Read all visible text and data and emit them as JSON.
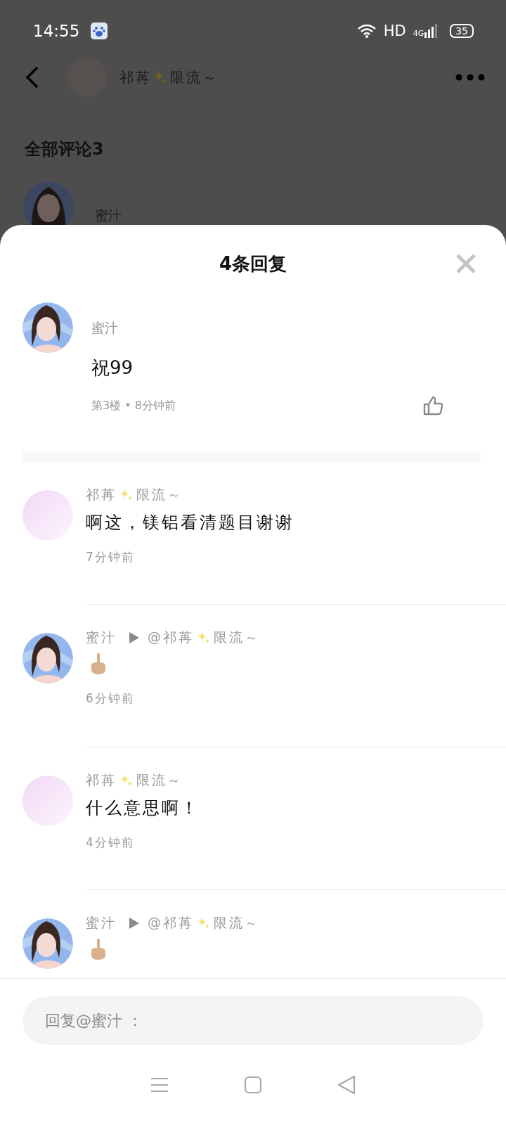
{
  "status_bar": {
    "time": "14:55",
    "network": "HD",
    "signal": "4G",
    "battery": "35"
  },
  "page": {
    "author": {
      "name": "祁苒",
      "sparkle": true,
      "suffix": "限流～"
    },
    "comments_heading": "全部评论3",
    "comment_author": "蜜汁"
  },
  "sheet": {
    "title": "4条回复",
    "main_comment": {
      "photo_avatar": true,
      "author": {
        "name": "蜜汁"
      },
      "body": "祝99",
      "meta": "第3楼 • 8分钟前"
    },
    "replies": [
      {
        "photo_avatar": false,
        "author": {
          "name": "祁苒",
          "sparkle": true,
          "suffix": "限流～"
        },
        "kind": "text",
        "body": "啊这，镁铝看清题目谢谢",
        "time": "7分钟前"
      },
      {
        "photo_avatar": true,
        "author": {
          "name": "蜜汁"
        },
        "reply_to": {
          "name": "@祁苒",
          "sparkle": true,
          "suffix": "限流～"
        },
        "kind": "emoji",
        "time": "6分钟前"
      },
      {
        "photo_avatar": false,
        "author": {
          "name": "祁苒",
          "sparkle": true,
          "suffix": "限流～"
        },
        "kind": "text",
        "body": "什么意思啊！",
        "time": "4分钟前"
      },
      {
        "photo_avatar": true,
        "author": {
          "name": "蜜汁"
        },
        "reply_to": {
          "name": "@祁苒",
          "sparkle": true,
          "suffix": "限流～"
        },
        "kind": "emoji"
      }
    ],
    "input": {
      "placeholder": "回复@蜜汁 ："
    }
  }
}
